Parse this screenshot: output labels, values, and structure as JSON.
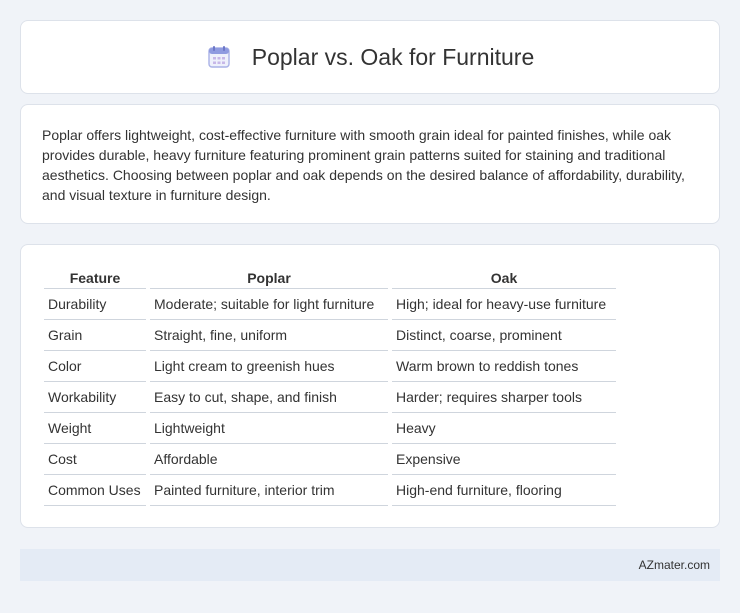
{
  "header": {
    "title": "Poplar vs. Oak for Furniture",
    "icon": "calendar-icon"
  },
  "description": "Poplar offers lightweight, cost-effective furniture with smooth grain ideal for painted finishes, while oak provides durable, heavy furniture featuring prominent grain patterns suited for staining and traditional aesthetics. Choosing between poplar and oak depends on the desired balance of affordability, durability, and visual texture in furniture design.",
  "table": {
    "headers": [
      "Feature",
      "Poplar",
      "Oak"
    ],
    "rows": [
      [
        "Durability",
        "Moderate; suitable for light furniture",
        "High; ideal for heavy-use furniture"
      ],
      [
        "Grain",
        "Straight, fine, uniform",
        "Distinct, coarse, prominent"
      ],
      [
        "Color",
        "Light cream to greenish hues",
        "Warm brown to reddish tones"
      ],
      [
        "Workability",
        "Easy to cut, shape, and finish",
        "Harder; requires sharper tools"
      ],
      [
        "Weight",
        "Lightweight",
        "Heavy"
      ],
      [
        "Cost",
        "Affordable",
        "Expensive"
      ],
      [
        "Common Uses",
        "Painted furniture, interior trim",
        "High-end furniture, flooring"
      ]
    ]
  },
  "footer": {
    "brand": "AZmater.com"
  }
}
